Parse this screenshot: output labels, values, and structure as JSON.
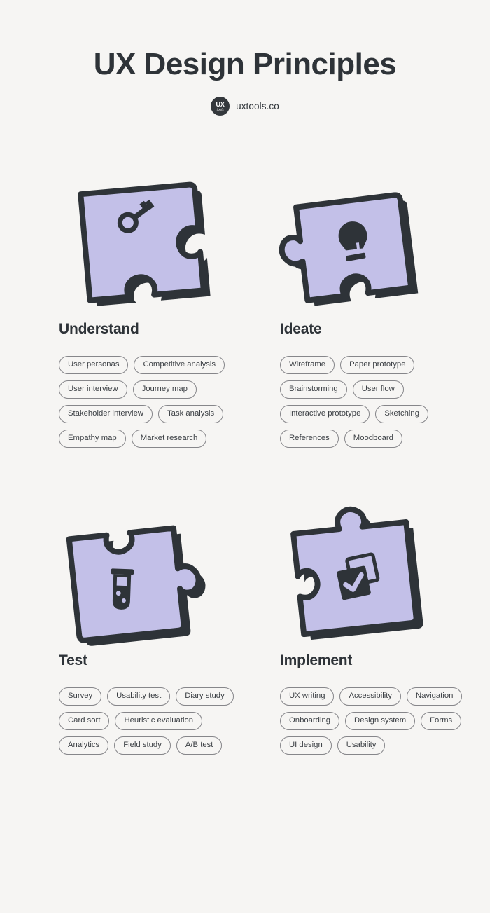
{
  "header": {
    "title": "UX Design Principles",
    "brand": {
      "logo_primary": "UX",
      "logo_secondary": "tools",
      "name": "uxtools.co"
    }
  },
  "colors": {
    "background": "#f6f5f3",
    "ink": "#2e3338",
    "piece_fill": "#c3c0e8",
    "piece_outline": "#2e3338",
    "tag_border": "#86868a",
    "tag_text": "#3c4045"
  },
  "sections": [
    {
      "id": "understand",
      "title": "Understand",
      "icon": "key-icon",
      "tags": [
        "User personas",
        "Competitive analysis",
        "User interview",
        "Journey map",
        "Stakeholder interview",
        "Task analysis",
        "Empathy map",
        "Market research"
      ]
    },
    {
      "id": "ideate",
      "title": "Ideate",
      "icon": "lightbulb-icon",
      "tags": [
        "Wireframe",
        "Paper prototype",
        "Brainstorming",
        "User flow",
        "Interactive prototype",
        "Sketching",
        "References",
        "Moodboard"
      ]
    },
    {
      "id": "test",
      "title": "Test",
      "icon": "test-tube-icon",
      "tags": [
        "Survey",
        "Usability test",
        "Diary study",
        "Card sort",
        "Heuristic evaluation",
        "Analytics",
        "Field study",
        "A/B test"
      ]
    },
    {
      "id": "implement",
      "title": "Implement",
      "icon": "checkbox-check-icon",
      "tags": [
        "UX writing",
        "Accessibility",
        "Navigation",
        "Onboarding",
        "Design system",
        "Forms",
        "UI design",
        "Usability"
      ]
    }
  ]
}
